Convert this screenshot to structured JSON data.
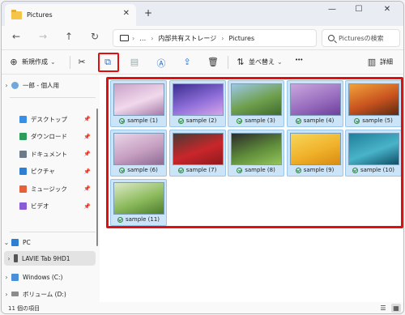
{
  "window": {
    "tab_title": "Pictures",
    "new_tab_symbol": "+",
    "close_tab_symbol": "✕",
    "minimize_symbol": "—",
    "maximize_symbol": "☐",
    "close_symbol": "✕"
  },
  "address": {
    "back_symbol": "←",
    "forward_symbol": "→",
    "up_symbol": "↑",
    "refresh_symbol": "↻",
    "ellipsis": "…",
    "crumb_sep": "›",
    "crumbs": [
      "内部共有ストレージ",
      "Pictures"
    ],
    "search_placeholder": "Picturesの検索"
  },
  "toolbar": {
    "new_label": "新規作成",
    "new_chevron": "⌄",
    "sort_label": "並べ替え",
    "sort_chevron": "⌄",
    "more_symbol": "•••",
    "details_label": "詳細",
    "icons": {
      "plus": "⊕",
      "cut": "✂",
      "copy": "⧉",
      "paste": "▤",
      "rename": "Ⓐ",
      "share": "⇪",
      "delete": "🗑",
      "sort": "⇅",
      "details": "▥"
    }
  },
  "sidebar": {
    "expand_symbol": "›",
    "collapse_symbol": "⌄",
    "pin_symbol": "📌",
    "home": "一郎 - 個人用",
    "quick_access": [
      {
        "label": "デスクトップ",
        "color": "#3a8ee6"
      },
      {
        "label": "ダウンロード",
        "color": "#2e9c5a"
      },
      {
        "label": "ドキュメント",
        "color": "#6c7a89"
      },
      {
        "label": "ピクチャ",
        "color": "#2f7fd1"
      },
      {
        "label": "ミュージック",
        "color": "#e5613a"
      },
      {
        "label": "ビデオ",
        "color": "#8a5bd6"
      }
    ],
    "pc_label": "PC",
    "device_label": "LAVIE Tab 9HD1",
    "drive_c": "Windows (C:)",
    "drive_d": "ボリューム (D:)"
  },
  "files": [
    {
      "name": "sample (1)",
      "colors": [
        "#c9a2c8",
        "#f1d9ec",
        "#a57aa8"
      ]
    },
    {
      "name": "sample (2)",
      "colors": [
        "#3a2f8f",
        "#8e6dd8",
        "#d6a6e8"
      ]
    },
    {
      "name": "sample (3)",
      "colors": [
        "#9cc7e6",
        "#6fa04d",
        "#3f6b2e"
      ]
    },
    {
      "name": "sample (4)",
      "colors": [
        "#c9a7dc",
        "#9a6fc0",
        "#6e3f9c"
      ]
    },
    {
      "name": "sample (5)",
      "colors": [
        "#f2a23a",
        "#c8531f",
        "#5c2a12"
      ]
    },
    {
      "name": "sample (6)",
      "colors": [
        "#e9d6e8",
        "#c7a0c2",
        "#8f6b95"
      ]
    },
    {
      "name": "sample (7)",
      "colors": [
        "#4a3b33",
        "#c9262b",
        "#8f1a1d"
      ]
    },
    {
      "name": "sample (8)",
      "colors": [
        "#2b2b2b",
        "#5f8d3a",
        "#94c45b"
      ]
    },
    {
      "name": "sample (9)",
      "colors": [
        "#f7d65a",
        "#f0b22b",
        "#d88c12"
      ]
    },
    {
      "name": "sample (10)",
      "colors": [
        "#1f7f9a",
        "#49b3c9",
        "#0e4f66"
      ]
    },
    {
      "name": "sample (11)",
      "colors": [
        "#dde9c9",
        "#8dbb5d",
        "#4e7d2e"
      ]
    }
  ],
  "status": {
    "item_count": "11 個の項目",
    "list_view_symbol": "☰",
    "grid_view_symbol": "▦"
  }
}
